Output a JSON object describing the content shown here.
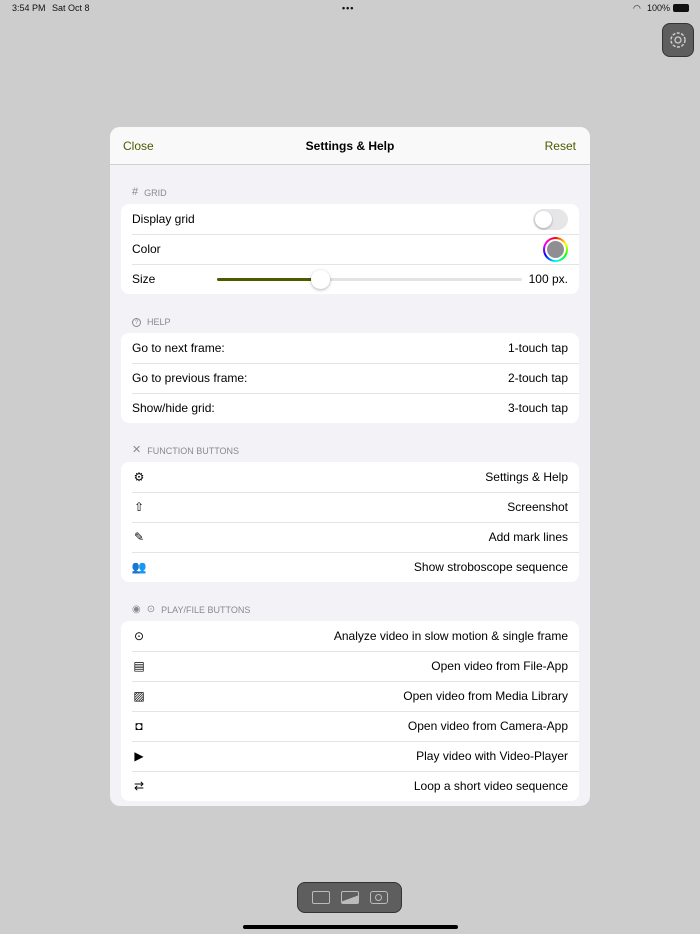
{
  "status": {
    "time": "3:54 PM",
    "date": "Sat Oct 8",
    "battery": "100%"
  },
  "modal": {
    "close": "Close",
    "title": "Settings & Help",
    "reset": "Reset"
  },
  "grid": {
    "label": "GRID",
    "display": "Display grid",
    "display_on": false,
    "color": "Color",
    "color_value": "#8e8e93",
    "size": "Size",
    "size_value": "100 px.",
    "size_fraction": 0.34
  },
  "help": {
    "label": "HELP",
    "rows": [
      {
        "k": "Go to next frame:",
        "v": "1-touch tap"
      },
      {
        "k": "Go to previous frame:",
        "v": "2-touch tap"
      },
      {
        "k": "Show/hide grid:",
        "v": "3-touch tap"
      }
    ]
  },
  "functions": {
    "label": "FUNCTION BUTTONS",
    "rows": [
      {
        "icon": "gear-play-icon",
        "v": "Settings & Help"
      },
      {
        "icon": "share-icon",
        "v": "Screenshot"
      },
      {
        "icon": "edit-icon",
        "v": "Add mark lines"
      },
      {
        "icon": "people-icon",
        "v": "Show stroboscope sequence"
      }
    ]
  },
  "play": {
    "label": "PLAY/FILE BUTTONS",
    "rows": [
      {
        "icon": "play-circle-icon",
        "v": "Analyze video in slow motion & single frame"
      },
      {
        "icon": "file-icon",
        "v": "Open video from File-App"
      },
      {
        "icon": "photo-icon",
        "v": "Open video from Media Library"
      },
      {
        "icon": "camera-icon",
        "v": "Open video from Camera-App"
      },
      {
        "icon": "play-rect-icon",
        "v": "Play video with Video-Player"
      },
      {
        "icon": "loop-icon",
        "v": "Loop a short video sequence"
      }
    ]
  },
  "accent": "#4e5a00"
}
